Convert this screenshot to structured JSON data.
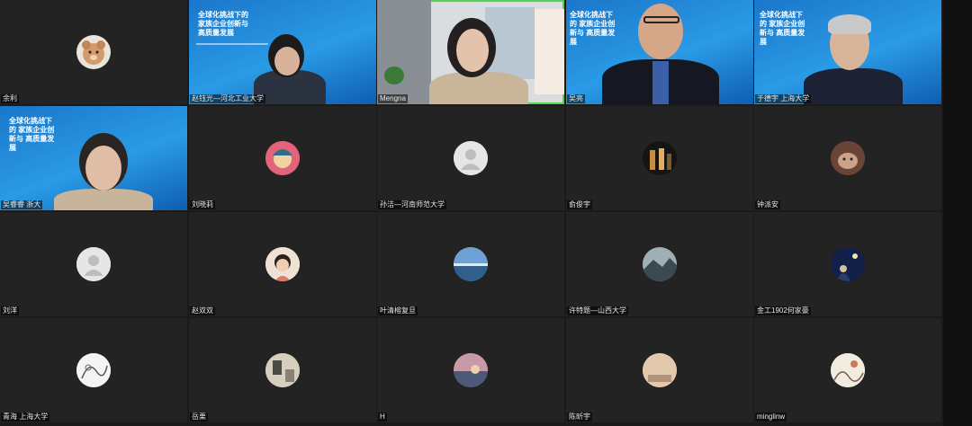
{
  "participants": [
    {
      "name": "余利",
      "type": "avatar",
      "avatar": "bear-plush-icon"
    },
    {
      "name": "赵钰光—河北工业大学",
      "type": "video-slide",
      "slide_title": "全球化挑战下的 家族企业创新与 高质量发展"
    },
    {
      "name": "Mengna",
      "type": "video-room",
      "active": true
    },
    {
      "name": "吴亮",
      "type": "video-slide",
      "slide_title": "全球化挑战下的 家族企业创新与 高质量发展"
    },
    {
      "name": "于德宇 上海大学",
      "type": "video-slide",
      "slide_title": "全球化挑战下的 家族企业创新与 高质量发展"
    },
    {
      "name": "吴睿睿 浙大",
      "type": "video-slide",
      "slide_title": "全球化挑战下的 家族企业创新与 高质量发展"
    },
    {
      "name": "刘晓莉",
      "type": "avatar",
      "avatar": "cartoon-avatar-icon"
    },
    {
      "name": "孙洁—河南师范大学",
      "type": "avatar",
      "avatar": "default-person-icon"
    },
    {
      "name": "俞俊宇",
      "type": "avatar",
      "avatar": "concert-photo-icon"
    },
    {
      "name": "钟派安",
      "type": "avatar",
      "avatar": "cat-photo-icon"
    },
    {
      "name": "刘洋",
      "type": "avatar",
      "avatar": "default-person-icon"
    },
    {
      "name": "赵双双",
      "type": "avatar",
      "avatar": "girl-photo-icon"
    },
    {
      "name": "叶清榕复旦",
      "type": "avatar",
      "avatar": "seascape-icon"
    },
    {
      "name": "许特题—山西大学",
      "type": "avatar",
      "avatar": "landscape-icon"
    },
    {
      "name": "金工1902何家豪",
      "type": "avatar",
      "avatar": "night-sky-icon"
    },
    {
      "name": "青海 上海大学",
      "type": "avatar",
      "avatar": "sketch-icon"
    },
    {
      "name": "岳栗",
      "type": "avatar",
      "avatar": "room-photo-icon"
    },
    {
      "name": "H",
      "type": "avatar",
      "avatar": "sunset-icon"
    },
    {
      "name": "陈昕宇",
      "type": "avatar",
      "avatar": "beige-photo-icon"
    },
    {
      "name": "minglinw",
      "type": "avatar",
      "avatar": "illustration-icon"
    }
  ],
  "colors": {
    "tile_bg": "#232323",
    "active_border": "#4fd24f",
    "slide_blue": "#2a9be6"
  }
}
